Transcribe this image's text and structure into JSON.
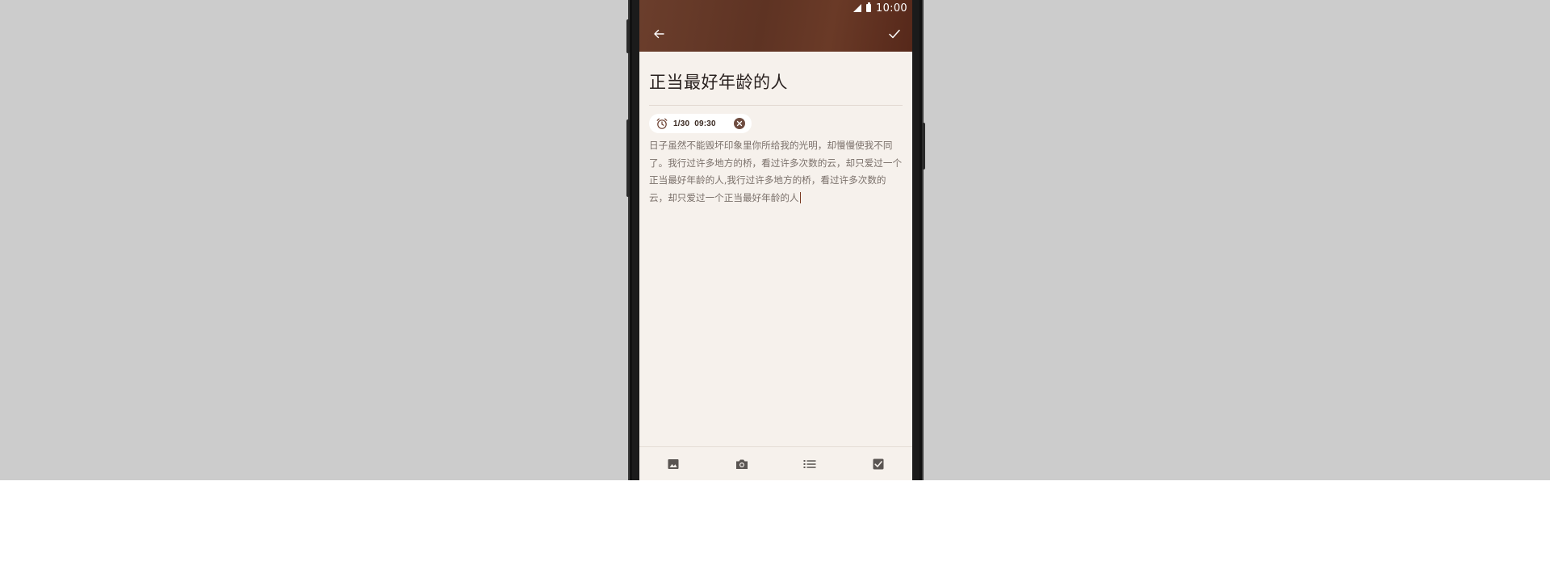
{
  "status_bar": {
    "time": "10:00",
    "icons": [
      "signal-icon",
      "battery-icon"
    ]
  },
  "header": {
    "back_icon": "arrow-back-icon",
    "confirm_icon": "check-icon"
  },
  "note": {
    "title": "正当最好年龄的人",
    "reminder": {
      "icon": "alarm-clock-icon",
      "text": "1/30  09:30",
      "clear_icon": "clear-icon"
    },
    "body": "日子虽然不能毁坏印象里你所给我的光明，却慢慢使我不同了。我行过许多地方的桥，看过许多次数的云，却只爱过一个正当最好年龄的人,我行过许多地方的桥，看过许多次数的云，却只爱过一个正当最好年龄的人"
  },
  "toolbar": {
    "items": [
      {
        "name": "insert-image",
        "icon": "image-icon"
      },
      {
        "name": "take-photo",
        "icon": "camera-icon"
      },
      {
        "name": "bullet-list",
        "icon": "list-icon"
      },
      {
        "name": "checklist",
        "icon": "checkbox-icon"
      }
    ]
  },
  "colors": {
    "header": "#5e3323",
    "screen_background": "#f6f1ec",
    "page_backdrop": "#cccccc",
    "body_text": "#7a706a",
    "cursor": "#7a3b22",
    "icon": "#5a5552"
  }
}
